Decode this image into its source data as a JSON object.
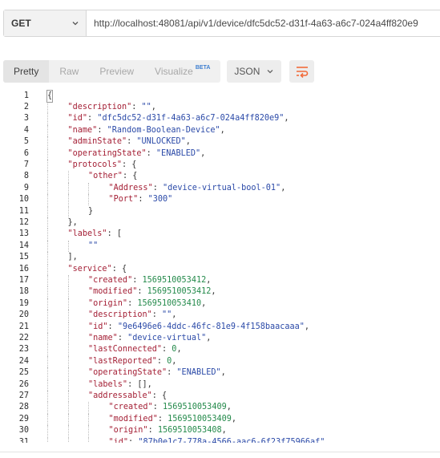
{
  "request": {
    "method": "GET",
    "url": "http://localhost:48081/api/v1/device/dfc5dc52-d31f-4a63-a6c7-024a4ff820e9"
  },
  "response": {
    "view_tabs": [
      {
        "label": "Pretty",
        "active": true
      },
      {
        "label": "Raw",
        "active": false
      },
      {
        "label": "Preview",
        "active": false
      },
      {
        "label": "Visualize",
        "active": false,
        "badge": "BETA"
      }
    ],
    "format": "JSON",
    "wrap_icon": "wrap-lines-icon"
  },
  "code_lines": [
    {
      "num": "1",
      "indent": 0,
      "tokens": [
        {
          "t": "{",
          "c": "p"
        }
      ]
    },
    {
      "num": "2",
      "indent": 1,
      "tokens": [
        {
          "t": "\"description\"",
          "c": "k"
        },
        {
          "t": ": ",
          "c": "p"
        },
        {
          "t": "\"\"",
          "c": "s"
        },
        {
          "t": ",",
          "c": "p"
        }
      ]
    },
    {
      "num": "3",
      "indent": 1,
      "tokens": [
        {
          "t": "\"id\"",
          "c": "k"
        },
        {
          "t": ": ",
          "c": "p"
        },
        {
          "t": "\"dfc5dc52-d31f-4a63-a6c7-024a4ff820e9\"",
          "c": "s"
        },
        {
          "t": ",",
          "c": "p"
        }
      ]
    },
    {
      "num": "4",
      "indent": 1,
      "tokens": [
        {
          "t": "\"name\"",
          "c": "k"
        },
        {
          "t": ": ",
          "c": "p"
        },
        {
          "t": "\"Random-Boolean-Device\"",
          "c": "s"
        },
        {
          "t": ",",
          "c": "p"
        }
      ]
    },
    {
      "num": "5",
      "indent": 1,
      "tokens": [
        {
          "t": "\"adminState\"",
          "c": "k"
        },
        {
          "t": ": ",
          "c": "p"
        },
        {
          "t": "\"UNLOCKED\"",
          "c": "s"
        },
        {
          "t": ",",
          "c": "p"
        }
      ]
    },
    {
      "num": "6",
      "indent": 1,
      "tokens": [
        {
          "t": "\"operatingState\"",
          "c": "k"
        },
        {
          "t": ": ",
          "c": "p"
        },
        {
          "t": "\"ENABLED\"",
          "c": "s"
        },
        {
          "t": ",",
          "c": "p"
        }
      ]
    },
    {
      "num": "7",
      "indent": 1,
      "tokens": [
        {
          "t": "\"protocols\"",
          "c": "k"
        },
        {
          "t": ": {",
          "c": "p"
        }
      ]
    },
    {
      "num": "8",
      "indent": 2,
      "tokens": [
        {
          "t": "\"other\"",
          "c": "k"
        },
        {
          "t": ": {",
          "c": "p"
        }
      ]
    },
    {
      "num": "9",
      "indent": 3,
      "tokens": [
        {
          "t": "\"Address\"",
          "c": "k"
        },
        {
          "t": ": ",
          "c": "p"
        },
        {
          "t": "\"device-virtual-bool-01\"",
          "c": "s"
        },
        {
          "t": ",",
          "c": "p"
        }
      ]
    },
    {
      "num": "10",
      "indent": 3,
      "tokens": [
        {
          "t": "\"Port\"",
          "c": "k"
        },
        {
          "t": ": ",
          "c": "p"
        },
        {
          "t": "\"300\"",
          "c": "s"
        }
      ]
    },
    {
      "num": "11",
      "indent": 2,
      "tokens": [
        {
          "t": "}",
          "c": "p"
        }
      ]
    },
    {
      "num": "12",
      "indent": 1,
      "tokens": [
        {
          "t": "},",
          "c": "p"
        }
      ]
    },
    {
      "num": "13",
      "indent": 1,
      "tokens": [
        {
          "t": "\"labels\"",
          "c": "k"
        },
        {
          "t": ": [",
          "c": "p"
        }
      ]
    },
    {
      "num": "14",
      "indent": 2,
      "tokens": [
        {
          "t": "\"\"",
          "c": "s"
        }
      ]
    },
    {
      "num": "15",
      "indent": 1,
      "tokens": [
        {
          "t": "],",
          "c": "p"
        }
      ]
    },
    {
      "num": "16",
      "indent": 1,
      "tokens": [
        {
          "t": "\"service\"",
          "c": "k"
        },
        {
          "t": ": {",
          "c": "p"
        }
      ]
    },
    {
      "num": "17",
      "indent": 2,
      "tokens": [
        {
          "t": "\"created\"",
          "c": "k"
        },
        {
          "t": ": ",
          "c": "p"
        },
        {
          "t": "1569510053412",
          "c": "n"
        },
        {
          "t": ",",
          "c": "p"
        }
      ]
    },
    {
      "num": "18",
      "indent": 2,
      "tokens": [
        {
          "t": "\"modified\"",
          "c": "k"
        },
        {
          "t": ": ",
          "c": "p"
        },
        {
          "t": "1569510053412",
          "c": "n"
        },
        {
          "t": ",",
          "c": "p"
        }
      ]
    },
    {
      "num": "19",
      "indent": 2,
      "tokens": [
        {
          "t": "\"origin\"",
          "c": "k"
        },
        {
          "t": ": ",
          "c": "p"
        },
        {
          "t": "1569510053410",
          "c": "n"
        },
        {
          "t": ",",
          "c": "p"
        }
      ]
    },
    {
      "num": "20",
      "indent": 2,
      "tokens": [
        {
          "t": "\"description\"",
          "c": "k"
        },
        {
          "t": ": ",
          "c": "p"
        },
        {
          "t": "\"\"",
          "c": "s"
        },
        {
          "t": ",",
          "c": "p"
        }
      ]
    },
    {
      "num": "21",
      "indent": 2,
      "tokens": [
        {
          "t": "\"id\"",
          "c": "k"
        },
        {
          "t": ": ",
          "c": "p"
        },
        {
          "t": "\"9e6496e6-4ddc-46fc-81e9-4f158baacaaa\"",
          "c": "s"
        },
        {
          "t": ",",
          "c": "p"
        }
      ]
    },
    {
      "num": "22",
      "indent": 2,
      "tokens": [
        {
          "t": "\"name\"",
          "c": "k"
        },
        {
          "t": ": ",
          "c": "p"
        },
        {
          "t": "\"device-virtual\"",
          "c": "s"
        },
        {
          "t": ",",
          "c": "p"
        }
      ]
    },
    {
      "num": "23",
      "indent": 2,
      "tokens": [
        {
          "t": "\"lastConnected\"",
          "c": "k"
        },
        {
          "t": ": ",
          "c": "p"
        },
        {
          "t": "0",
          "c": "n"
        },
        {
          "t": ",",
          "c": "p"
        }
      ]
    },
    {
      "num": "24",
      "indent": 2,
      "tokens": [
        {
          "t": "\"lastReported\"",
          "c": "k"
        },
        {
          "t": ": ",
          "c": "p"
        },
        {
          "t": "0",
          "c": "n"
        },
        {
          "t": ",",
          "c": "p"
        }
      ]
    },
    {
      "num": "25",
      "indent": 2,
      "tokens": [
        {
          "t": "\"operatingState\"",
          "c": "k"
        },
        {
          "t": ": ",
          "c": "p"
        },
        {
          "t": "\"ENABLED\"",
          "c": "s"
        },
        {
          "t": ",",
          "c": "p"
        }
      ]
    },
    {
      "num": "26",
      "indent": 2,
      "tokens": [
        {
          "t": "\"labels\"",
          "c": "k"
        },
        {
          "t": ": [],",
          "c": "p"
        }
      ]
    },
    {
      "num": "27",
      "indent": 2,
      "tokens": [
        {
          "t": "\"addressable\"",
          "c": "k"
        },
        {
          "t": ": {",
          "c": "p"
        }
      ]
    },
    {
      "num": "28",
      "indent": 3,
      "tokens": [
        {
          "t": "\"created\"",
          "c": "k"
        },
        {
          "t": ": ",
          "c": "p"
        },
        {
          "t": "1569510053409",
          "c": "n"
        },
        {
          "t": ",",
          "c": "p"
        }
      ]
    },
    {
      "num": "29",
      "indent": 3,
      "tokens": [
        {
          "t": "\"modified\"",
          "c": "k"
        },
        {
          "t": ": ",
          "c": "p"
        },
        {
          "t": "1569510053409",
          "c": "n"
        },
        {
          "t": ",",
          "c": "p"
        }
      ]
    },
    {
      "num": "30",
      "indent": 3,
      "tokens": [
        {
          "t": "\"origin\"",
          "c": "k"
        },
        {
          "t": ": ",
          "c": "p"
        },
        {
          "t": "1569510053408",
          "c": "n"
        },
        {
          "t": ",",
          "c": "p"
        }
      ]
    },
    {
      "num": "31",
      "indent": 3,
      "tokens": [
        {
          "t": "\"id\"",
          "c": "k"
        },
        {
          "t": ": ",
          "c": "p"
        },
        {
          "t": "\"87b0e1c7-778a-4566-aac6-6f23f75966af\"",
          "c": "s"
        },
        {
          "t": ",",
          "c": "p"
        }
      ]
    }
  ],
  "colors": {
    "key": "#a41f35",
    "string": "#2b4aa8",
    "number": "#248a4b",
    "punctuation": "#333333",
    "accent": "#f26b3a"
  }
}
